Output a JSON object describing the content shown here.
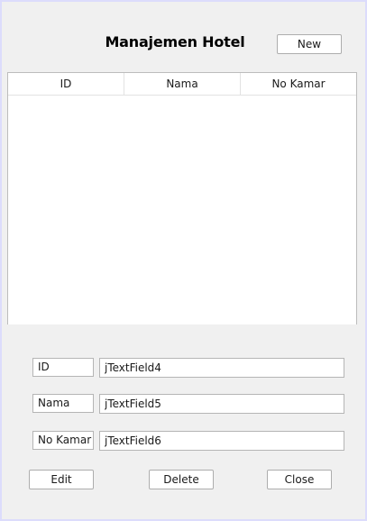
{
  "header": {
    "title": "Manajemen Hotel",
    "new_label": "New"
  },
  "table": {
    "columns": [
      "ID",
      "Nama",
      "No Kamar"
    ],
    "rows": []
  },
  "form": {
    "id_label": "ID",
    "id_value": "jTextField4",
    "nama_label": "Nama",
    "nama_value": "jTextField5",
    "nokamar_label": "No Kamar",
    "nokamar_value": "jTextField6"
  },
  "actions": {
    "edit_label": "Edit",
    "delete_label": "Delete",
    "close_label": "Close"
  },
  "colors": {
    "window_bg": "#f0f0f0",
    "window_border": "#dcdcfc",
    "control_bg": "#ffffff",
    "control_border": "#adadad"
  }
}
